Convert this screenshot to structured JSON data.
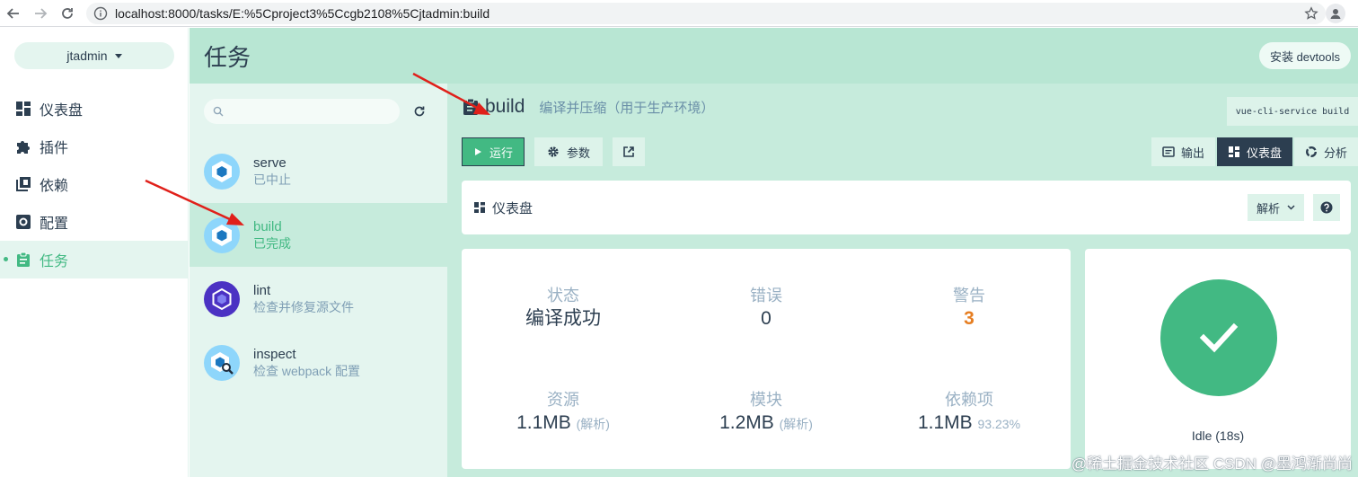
{
  "browser": {
    "url": "localhost:8000/tasks/E:%5Cproject3%5Ccgb2108%5Cjtadmin:build"
  },
  "sidebar": {
    "project_name": "jtadmin",
    "items": [
      {
        "label": "仪表盘",
        "icon": "dashboard-icon"
      },
      {
        "label": "插件",
        "icon": "puzzle-icon"
      },
      {
        "label": "依赖",
        "icon": "library-icon"
      },
      {
        "label": "配置",
        "icon": "settings-icon"
      },
      {
        "label": "任务",
        "icon": "assignment-icon",
        "active": true
      }
    ]
  },
  "header": {
    "title": "任务",
    "devtools_label": "安装 devtools"
  },
  "tasks": {
    "search_placeholder": "",
    "items": [
      {
        "name": "serve",
        "desc": "已中止",
        "icon": "webpack-icon"
      },
      {
        "name": "build",
        "desc": "已完成",
        "icon": "webpack-icon",
        "selected": true
      },
      {
        "name": "lint",
        "desc": "检查并修复源文件",
        "icon": "eslint-icon"
      },
      {
        "name": "inspect",
        "desc": "检查 webpack 配置",
        "icon": "webpack-inspect-icon"
      }
    ]
  },
  "task_detail": {
    "name": "build",
    "description": "编译并压缩（用于生产环境）",
    "command": "vue-cli-service build",
    "run_label": "运行",
    "params_label": "参数",
    "view_tabs": [
      {
        "label": "输出",
        "icon": "output-icon"
      },
      {
        "label": "仪表盘",
        "icon": "dashboard-icon",
        "active": true
      },
      {
        "label": "分析",
        "icon": "donut-icon"
      }
    ]
  },
  "dashboard": {
    "title": "仪表盘",
    "analyze_label": "解析",
    "stats": {
      "status_label": "状态",
      "status_value": "编译成功",
      "errors_label": "错误",
      "errors_value": "0",
      "warnings_label": "警告",
      "warnings_value": "3",
      "assets_label": "资源",
      "assets_value": "1.1MB",
      "assets_hint": "(解析)",
      "modules_label": "模块",
      "modules_value": "1.2MB",
      "modules_hint": "(解析)",
      "deps_label": "依赖项",
      "deps_value": "1.1MB",
      "deps_hint": "93.23%"
    },
    "idle_text": "Idle (18s)"
  },
  "watermark": "@稀土掘金技术社区 CSDN @墨鸿渐尚尚",
  "colors": {
    "accent": "#42b983",
    "dark": "#2c3e50",
    "header_bg": "#b8e6d3",
    "panel_bg": "#e4f5ef",
    "content_bg": "#c6ebdc",
    "warning": "#e67e22",
    "annotation_arrow": "#e0201a"
  }
}
